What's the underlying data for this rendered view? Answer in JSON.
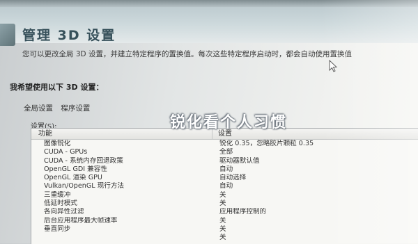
{
  "page": {
    "title": "管理 3D 设置",
    "description": "您可以更改全局 3D 设置，并建立特定程序的置换值。每次这些特定程序启动时，都会自动使用置换值",
    "settings_heading": "我希望使用以下 3D 设置：",
    "tabs": [
      "全局设置",
      "程序设置"
    ],
    "settings_label": "设置(S):"
  },
  "table": {
    "headers": {
      "feature": "功能",
      "setting": "设置"
    },
    "rows": [
      {
        "feature": "图像锐化",
        "setting": "锐化 0.35，忽略胶片颗粒 0.35"
      },
      {
        "feature": "CUDA - GPUs",
        "setting": "全部"
      },
      {
        "feature": "CUDA - 系统内存回退政策",
        "setting": "驱动器默认值"
      },
      {
        "feature": "OpenGL GDI 兼容性",
        "setting": "自动"
      },
      {
        "feature": "OpenGL 渲染 GPU",
        "setting": "自动选择"
      },
      {
        "feature": "Vulkan/OpenGL 现行方法",
        "setting": "自动"
      },
      {
        "feature": "三重缓冲",
        "setting": "关"
      },
      {
        "feature": "低延时模式",
        "setting": "关"
      },
      {
        "feature": "各向异性过滤",
        "setting": "应用程序控制的"
      },
      {
        "feature": "后台应用程序最大帧速率",
        "setting": "关"
      },
      {
        "feature": "垂直同步",
        "setting": "关"
      },
      {
        "feature": "",
        "setting": "关"
      }
    ]
  },
  "overlay": {
    "caption": "锐化看个人习惯"
  },
  "colors": {
    "title": "#36505a",
    "header_band": "#c6d3d7",
    "caption": "#ffffff"
  }
}
